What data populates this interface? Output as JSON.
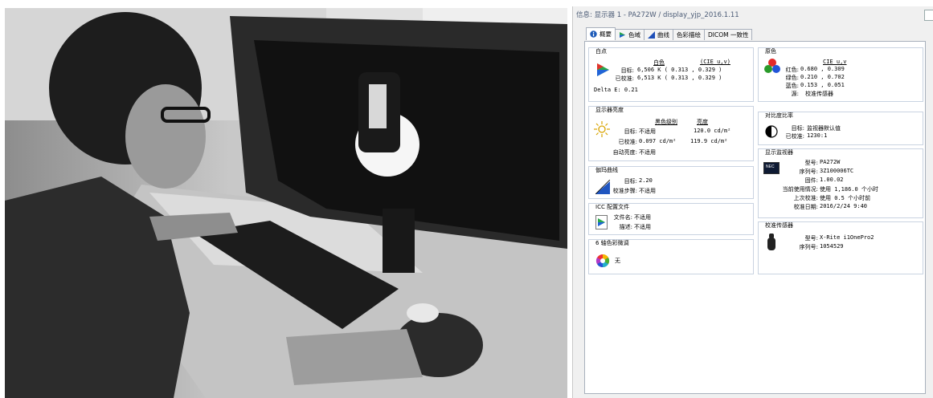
{
  "window": {
    "title": "信息: 显示器 1 - PA272W / display_yjp_2016.1.11"
  },
  "tabs": [
    {
      "label": "概要",
      "icon": "info-icon"
    },
    {
      "label": "色域",
      "icon": "gamut-icon"
    },
    {
      "label": "曲线",
      "icon": "curve-icon"
    },
    {
      "label": "色彩描绘",
      "icon": ""
    },
    {
      "label": "DICOM 一致性",
      "icon": ""
    }
  ],
  "white_point": {
    "title": "白点",
    "col_whitepoint": "白色",
    "col_cie": "(CIE u,v)",
    "target_label": "目标:",
    "target_value": "6,506 K ( 0.313 , 0.329 )",
    "calibrated_label": "已校准:",
    "calibrated_value": "6,513 K ( 0.313 , 0.329 )",
    "delta_e": "Delta E: 0.21"
  },
  "brightness": {
    "title": "显示器亮度",
    "col_black": "黑色级别",
    "col_bright": "亮度",
    "target_label": "目标:",
    "target_black": "不适用",
    "target_bright": "120.0 cd/m²",
    "calibrated_label": "已校准:",
    "calibrated_black": "0.097 cd/m²",
    "calibrated_bright": "119.9 cd/m²",
    "auto_label": "自动亮度:",
    "auto_value": "不适用"
  },
  "gamma": {
    "title": "伽玛曲线",
    "target_label": "目标:",
    "target_value": "2.20",
    "step_label": "校准步骤:",
    "step_value": "不适用"
  },
  "icc": {
    "title": "ICC 配置文件",
    "file_label": "文件名:",
    "file_value": "不适用",
    "desc_label": "描述:",
    "desc_value": "不适用"
  },
  "six_axis": {
    "title": "6 轴色彩微调",
    "value": "无"
  },
  "primaries": {
    "title": "原色",
    "col_cie": "CIE u,v",
    "red_label": "红色:",
    "red_value": "0.680 , 0.309",
    "green_label": "绿色:",
    "green_value": "0.210 , 0.702",
    "blue_label": "蓝色:",
    "blue_value": "0.153 , 0.051",
    "source_label": "源:",
    "source_value": "校准传感器"
  },
  "contrast": {
    "title": "对比度比率",
    "target_label": "目标:",
    "target_value": "监视器默认值",
    "calibrated_label": "已校准:",
    "calibrated_value": "1230:1"
  },
  "monitor": {
    "title": "显示监视器",
    "logo_text": "NEC",
    "model_label": "型号:",
    "model_value": "PA272W",
    "serial_label": "序列号:",
    "serial_value": "3Z100006TC",
    "firmware_label": "固件:",
    "firmware_value": "1.00.02",
    "usage_label": "当前使用情况:",
    "usage_value": "使用 1,186.0 个小时",
    "last_label": "上次校准:",
    "last_value": "使用 0.5 个小时前",
    "date_label": "校准日期:",
    "date_value": "2016/2/24 9:40"
  },
  "sensor": {
    "title": "校准传感器",
    "model_label": "型号:",
    "model_value": "X-Rite i1OnePro2",
    "serial_label": "序列号:",
    "serial_value": "1054529"
  },
  "colors": {
    "accent": "#1e5bb8",
    "border": "#c9d3e1"
  }
}
